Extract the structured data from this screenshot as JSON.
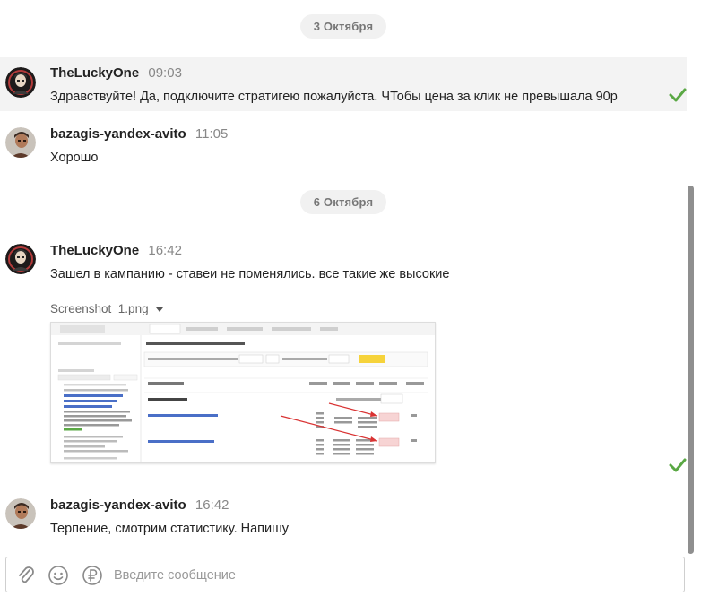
{
  "dates": [
    {
      "label": "3 Октября"
    },
    {
      "label": "6 Октября"
    }
  ],
  "messages": [
    {
      "author": "TheLuckyOne",
      "time": "09:03",
      "text": "Здравствуйте! Да, подключите стратигею пожалуйста. ЧТобы цена за клик не превышала 90р"
    },
    {
      "author": "bazagis-yandex-avito",
      "time": "11:05",
      "text": "Хорошо"
    },
    {
      "author": "TheLuckyOne",
      "time": "16:42",
      "text": "Зашел в кампанию - ставеи не поменялись. все такие же высокие"
    },
    {
      "author": "bazagis-yandex-avito",
      "time": "16:42",
      "text": "Терпение, смотрим статистику. Напишу"
    }
  ],
  "attachment": {
    "filename": "Screenshot_1.png"
  },
  "composer": {
    "placeholder": "Введите сообщение"
  },
  "colors": {
    "check": "#5aa844",
    "highlight_row": "#f3f3f3",
    "date_pill": "#f1f1f1"
  },
  "icons": [
    "paperclip-icon",
    "smiley-icon",
    "ruble-icon",
    "check-icon"
  ]
}
